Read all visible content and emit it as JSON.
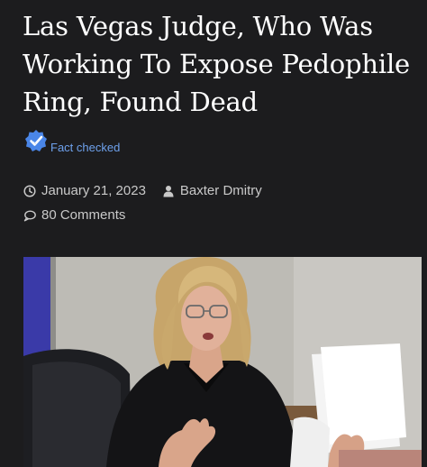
{
  "article": {
    "headline": "Las Vegas Judge, Who Was Working To Expose Pedophile Ring, Found Dead",
    "fact_check_label": "Fact checked",
    "date": "January 21, 2023",
    "author": "Baxter Dmitry",
    "comments": "80 Comments"
  },
  "icons": {
    "fact_check": "verified-check-badge-icon",
    "date": "clock-icon",
    "author": "person-icon",
    "comments": "speech-bubble-icon"
  },
  "colors": {
    "background": "#1c1c1e",
    "accent": "#4a86e8",
    "text": "#ffffff",
    "meta_text": "#c9c9c9"
  }
}
